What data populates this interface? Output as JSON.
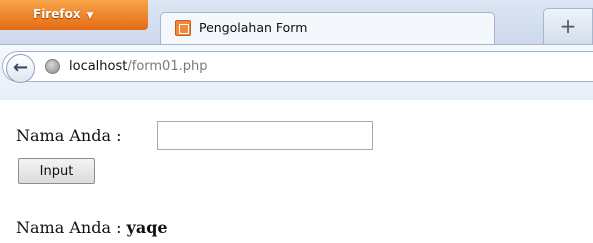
{
  "browser": {
    "menu_button_label": "Firefox",
    "menu_caret": "▼",
    "new_tab_label": "+",
    "tabs": [
      {
        "title": "Pengolahan Form",
        "icon": "form-favicon-icon",
        "active": true
      }
    ]
  },
  "navigation": {
    "back_label": "←",
    "site_icon": "globe-icon",
    "url_host": "localhost",
    "url_path": "/form01.php"
  },
  "form": {
    "name_label": "Nama Anda :",
    "name_value": "",
    "submit_label": "Input"
  },
  "result": {
    "label": "Nama Anda :",
    "value": "yaqe"
  },
  "colors": {
    "firefox_orange": "#e46a12",
    "tab_background": "#f4f7fb",
    "chrome_blue": "#cdd9ec"
  }
}
